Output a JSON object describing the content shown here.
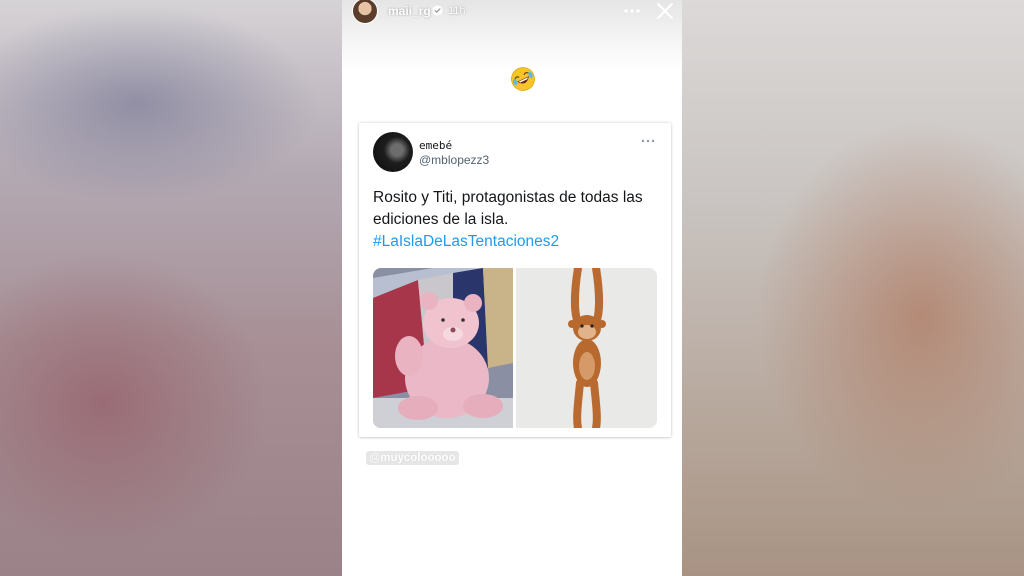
{
  "story": {
    "username": "maii_rg",
    "time_ago": "11h",
    "mention": "@muycolooooo"
  },
  "tweet": {
    "display_name": "emebé",
    "handle": "@mblopezz3",
    "text": "Rosito y Titi, protagonistas de todas las ediciones de la isla.",
    "hashtag": "#LaIslaDeLasTentaciones2"
  },
  "colors": {
    "hashtag": "#1d9bf0",
    "verified": "#ffffff"
  },
  "icons": {
    "verified": "verified-badge-icon",
    "more": "more-horizontal-icon",
    "close": "close-icon",
    "emoji": "rolling-on-floor-laughing-emoji"
  }
}
